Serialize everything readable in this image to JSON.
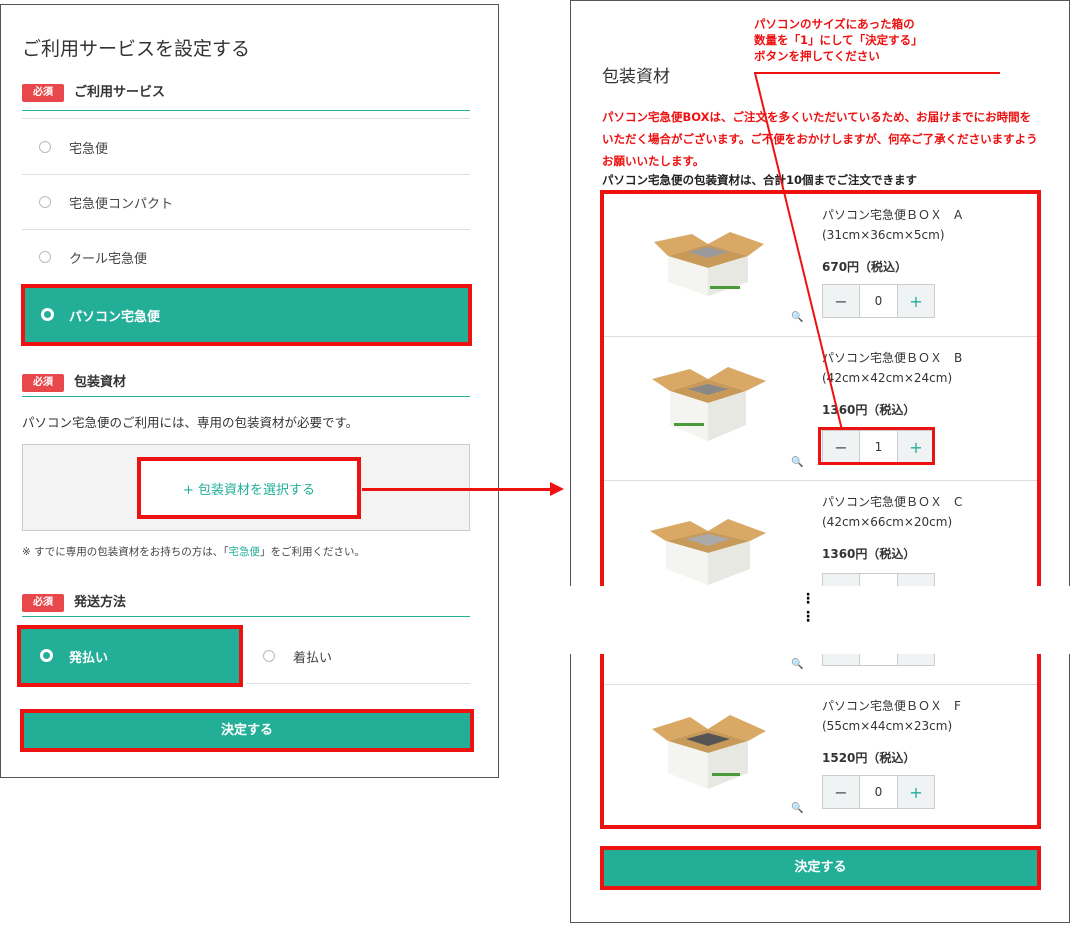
{
  "left": {
    "title": "ご利用サービスを設定する",
    "required_badge": "必須",
    "service_section": "ご利用サービス",
    "services": [
      "宅急便",
      "宅急便コンパクト",
      "クール宅急便",
      "パソコン宅急便"
    ],
    "selected_service": "パソコン宅急便",
    "packaging_section": "包装資材",
    "packaging_desc": "パソコン宅急便のご利用には、専用の包装資材が必要です。",
    "packaging_select": "+ 包装資材を選択する",
    "note_prefix": "※ すでに専用の包装資材をお持ちの方は、「",
    "note_link": "宅急便",
    "note_suffix": "」をご利用ください。",
    "shipping_section": "発送方法",
    "shipping_options": [
      "発払い",
      "着払い"
    ],
    "selected_shipping": "発払い",
    "submit": "決定する"
  },
  "right": {
    "title": "包装資材",
    "callout": "パソコンのサイズにあった箱の数量を「1」にして「決定する」ボタンを押してください",
    "callout_lines": [
      "パソコンのサイズにあった箱の",
      "数量を「1」にして「決定する」",
      "ボタンを押してください"
    ],
    "notice": "パソコン宅急便BOXは、ご注文を多くいただいているため、お届けまでにお時間をいただく場合がございます。ご不便をおかけしますが、何卒ご了承くださいますようお願いいたします。",
    "limit": "パソコン宅急便の包装資材は、合計10個までご注文できます",
    "products": [
      {
        "name": "パソコン宅急便ＢＯＸ　A",
        "size": "(31cm×36cm×5cm)",
        "price": "670円（税込）",
        "qty": "0"
      },
      {
        "name": "パソコン宅急便ＢＯＸ　B",
        "size": "(42cm×42cm×24cm)",
        "price": "1360円（税込）",
        "qty": "1"
      },
      {
        "name": "パソコン宅急便ＢＯＸ　C",
        "size": "(42cm×66cm×20cm)",
        "price": "1360円（税込）",
        "qty": ""
      },
      {
        "name": "パソコン宅急便ＢＯＸ　F",
        "size": "(55cm×44cm×23cm)",
        "price": "1520円（税込）",
        "qty": "0"
      }
    ],
    "minus": "−",
    "plus": "+",
    "dots": "⋮",
    "submit": "決定する"
  }
}
